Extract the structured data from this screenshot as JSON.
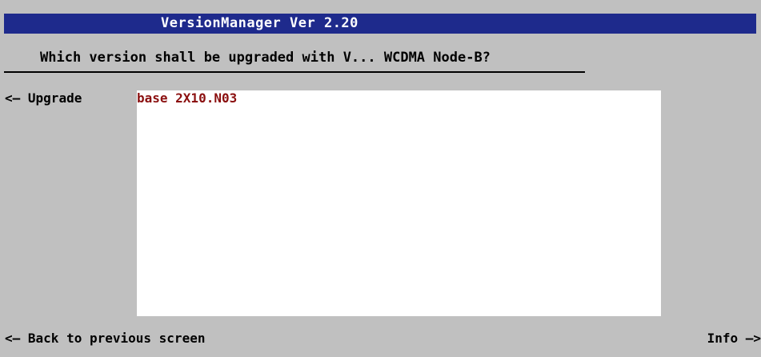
{
  "window": {
    "title": "VersionManager Ver 2.20"
  },
  "question": "Which version shall be upgraded with V... WCDMA Node-B?",
  "softkeys": {
    "upgrade": {
      "arrow": "<—",
      "label": "Upgrade"
    },
    "back": {
      "arrow": "<—",
      "label": "Back to previous screen"
    },
    "info": {
      "label": "Info",
      "arrow": "—>"
    }
  },
  "versions": [
    {
      "label": "base 2X10.N03"
    }
  ],
  "colors": {
    "background": "#c0c0c0",
    "title_bar": "#1e2a8c",
    "title_text": "#ffffff",
    "list_background": "#ffffff",
    "version_text": "#8b1010"
  }
}
